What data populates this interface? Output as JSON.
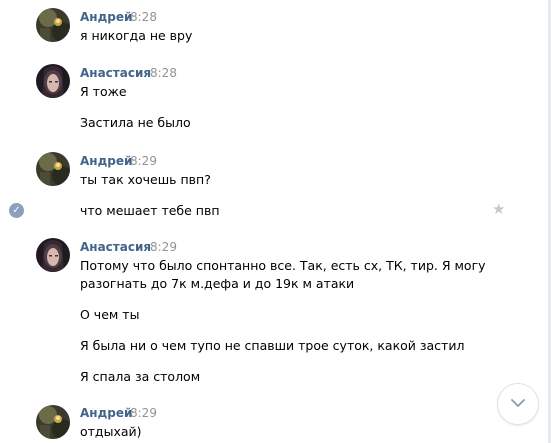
{
  "messages": [
    {
      "author": "Андрей",
      "time": "8:28",
      "lines": [
        "я никогда не вру"
      ]
    },
    {
      "author": "Анастасия",
      "time": "8:28",
      "lines": [
        "Я тоже",
        "Застила не было"
      ]
    },
    {
      "author": "Андрей",
      "time": "8:29",
      "lines": [
        "ты так хочешь пвп?",
        "что мешает тебе пвп"
      ]
    },
    {
      "author": "Анастасия",
      "time": "8:29",
      "lines": [
        "Потому что было спонтанно все. Так, есть сх, ТК, тир. Я могу",
        "разогнать до 7к м.дефа и до 19к м атаки",
        "О чем ты",
        "Я была ни о чем тупо не спавши трое суток, какой застил",
        "Я спала за столом"
      ]
    },
    {
      "author": "Андрей",
      "time": "8:29",
      "lines": [
        "отдыхай)"
      ]
    }
  ],
  "icons": {
    "read_check": "check-icon",
    "favorite": "star-icon",
    "scroll_down": "chevron-down-icon"
  },
  "colors": {
    "author": "#42648b",
    "time": "#939393",
    "check_badge": "#8aa0bc",
    "star": "#c3cad4"
  }
}
